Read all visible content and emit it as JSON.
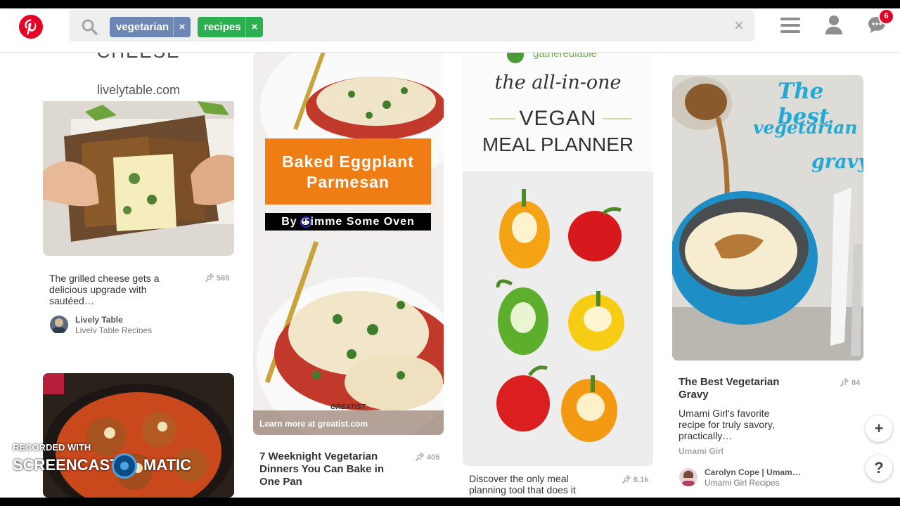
{
  "search": {
    "chips": [
      {
        "label": "vegetarian",
        "color": "#6d87b5"
      },
      {
        "label": "recipes",
        "color": "#2cb04f"
      }
    ],
    "remove_glyph": "×",
    "clear_glyph": "×"
  },
  "notifications": {
    "count": "6"
  },
  "pins": [
    {
      "image_text_top": "CHEESE",
      "image_text_site": "livelytable.com",
      "description": "The grilled cheese gets a delicious upgrade with sautéed…",
      "saves": "569",
      "source_name": "Lively Table",
      "source_board": "Lively Table Recipes"
    },
    {
      "image_title_line1": "Baked Eggplant",
      "image_title_line2": "Parmesan",
      "image_byline": "By Gimme Some Oven",
      "image_footer": "Learn more at greatist.com",
      "image_watermark": "GREATIST",
      "title": "7 Weeknight Vegetarian Dinners You Can Bake in One Pan",
      "saves": "405"
    },
    {
      "image_brand": "gatherediable",
      "image_script": "the all-in-one",
      "image_title_line1": "VEGAN",
      "image_title_line2": "MEAL PLANNER",
      "description": "Discover the only meal planning tool that does it all…",
      "saves": "6.1k"
    },
    {
      "image_script_line1": "The best",
      "image_script_line2": "vegetarian",
      "image_script_line3": "gravy",
      "title": "The Best Vegetarian Gravy",
      "description": "Umami Girl's favorite recipe for truly savory, practically…",
      "saves": "84",
      "attribution": "Umami Girl",
      "source_name": "Carolyn Cope | Umam…",
      "source_board": "Umami Girl Recipes"
    }
  ],
  "fab": {
    "add": "+",
    "help": "?"
  },
  "watermark": {
    "top": "RECORDED WITH",
    "left": "SCREENCAST",
    "right": "MATIC"
  }
}
